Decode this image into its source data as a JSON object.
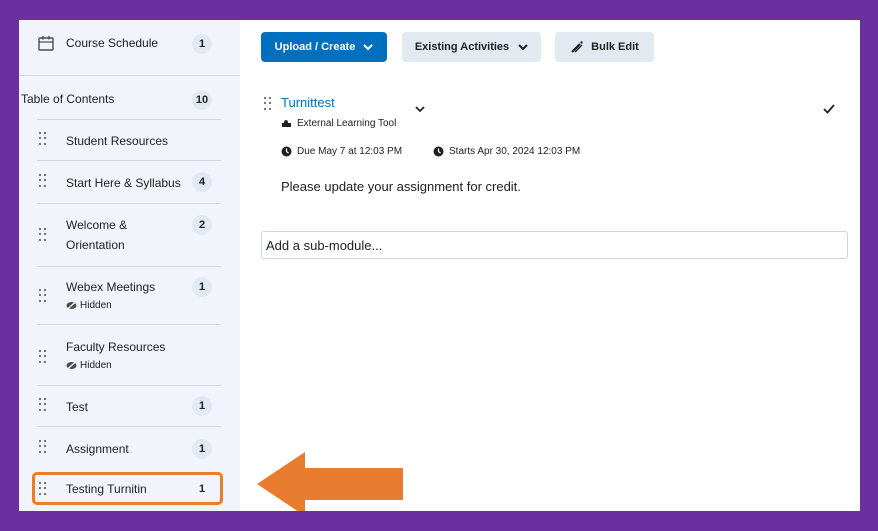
{
  "sidebar": {
    "items": [
      {
        "label": "Course Schedule",
        "count": "1",
        "icon": "calendar-icon"
      },
      {
        "label": "Table of Contents",
        "count": "10"
      },
      {
        "label": "Student Resources"
      },
      {
        "label": "Start Here & Syllabus",
        "count": "4"
      },
      {
        "label_line1": "Welcome &",
        "label_line2": "Orientation",
        "count": "2"
      },
      {
        "label": "Webex Meetings",
        "count": "1",
        "status": "Hidden"
      },
      {
        "label": "Faculty Resources",
        "status": "Hidden"
      },
      {
        "label": "Test",
        "count": "1"
      },
      {
        "label": "Assignment",
        "count": "1"
      },
      {
        "label": "Testing Turnitin",
        "count": "1",
        "selected": true
      }
    ]
  },
  "toolbar": {
    "upload_label": "Upload / Create",
    "existing_label": "Existing Activities",
    "bulk_label": "Bulk Edit"
  },
  "topic": {
    "title": "Turnittest",
    "type": "External Learning Tool",
    "due": "Due May 7 at 12:03 PM",
    "starts": "Starts Apr 30, 2024 12:03 PM",
    "description": "Please update your assignment for credit."
  },
  "submodule": {
    "placeholder": "Add a sub-module..."
  },
  "colors": {
    "accent": "#006fbf",
    "frame": "#6b2fa0",
    "annotation": "#e87d2f",
    "sidebar_bg": "#f1f5fb"
  }
}
